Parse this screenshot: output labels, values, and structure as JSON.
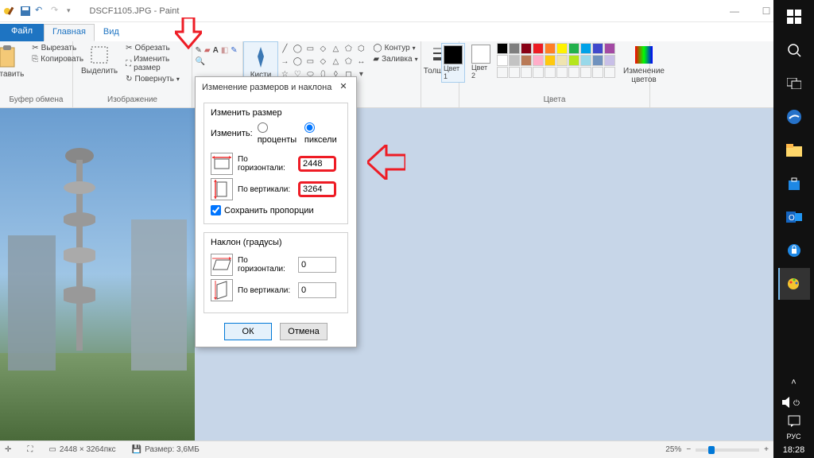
{
  "app": {
    "title": "DSCF1105.JPG - Paint"
  },
  "tabs": {
    "file": "Файл",
    "home": "Главная",
    "view": "Вид"
  },
  "ribbon": {
    "clipboard": {
      "paste": "Вставить",
      "cut": "Вырезать",
      "copy": "Копировать",
      "label": "Буфер обмена"
    },
    "image": {
      "select": "Выделить",
      "crop": "Обрезать",
      "resize": "Изменить размер",
      "rotate": "Повернуть",
      "label": "Изображение"
    },
    "brushes": {
      "brushes": "Кисти"
    },
    "shapes": {
      "outline": "Контур",
      "fill": "Заливка"
    },
    "size": {
      "label": "Толщина"
    },
    "colors": {
      "c1": "Цвет 1",
      "c2": "Цвет 2",
      "edit": "Изменение цветов",
      "label": "Цвета"
    }
  },
  "dialog": {
    "title": "Изменение размеров и наклона",
    "resize_group": "Изменить размер",
    "change_label": "Изменить:",
    "percent": "проценты",
    "pixels": "пиксели",
    "horiz": "По горизонтали:",
    "vert": "По вертикали:",
    "h_val": "2448",
    "v_val": "3264",
    "keep_ratio": "Сохранить пропорции",
    "skew_group": "Наклон (градусы)",
    "skew_h": "0",
    "skew_v": "0",
    "ok": "ОК",
    "cancel": "Отмена"
  },
  "statusbar": {
    "dims": "2448 × 3264пкс",
    "size_lbl": "Размер: 3,6МБ",
    "zoom": "25%"
  },
  "taskbar": {
    "lang": "РУС",
    "time": "18:28"
  }
}
